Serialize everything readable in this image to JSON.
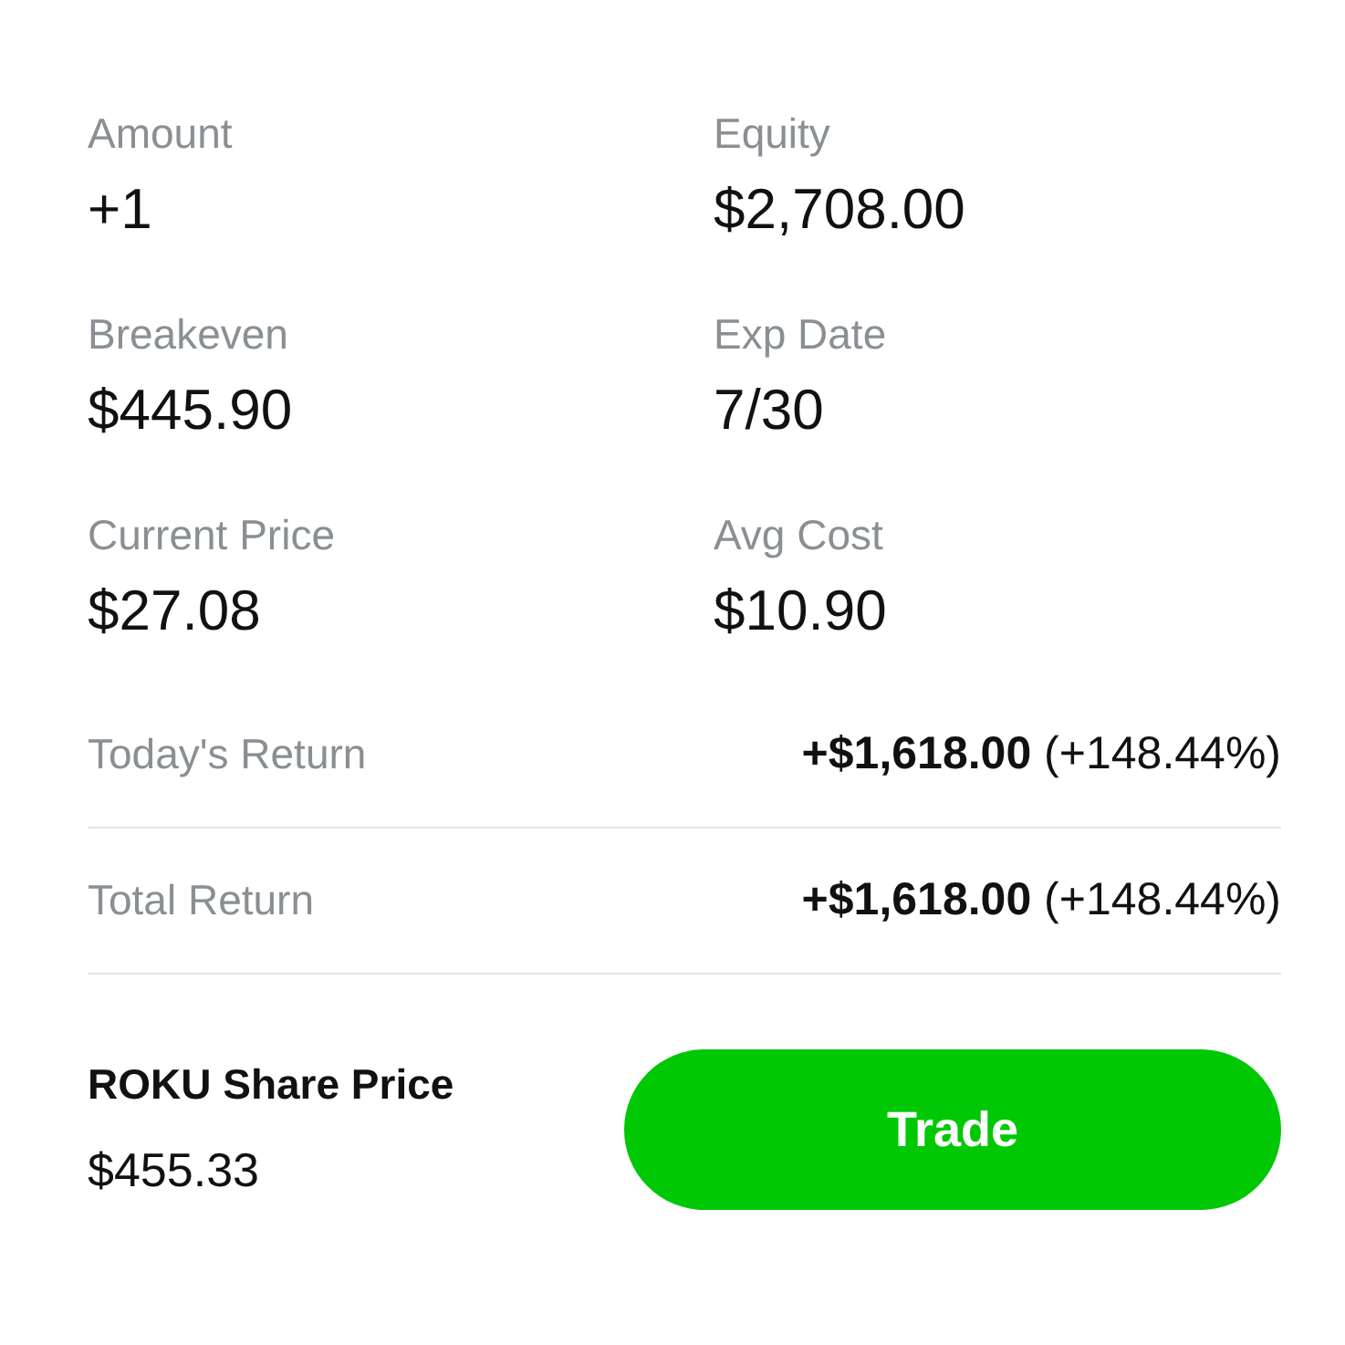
{
  "stats": [
    {
      "label": "Amount",
      "value": "+1"
    },
    {
      "label": "Equity",
      "value": "$2,708.00"
    },
    {
      "label": "Breakeven",
      "value": "$445.90"
    },
    {
      "label": "Exp Date",
      "value": "7/30"
    },
    {
      "label": "Current Price",
      "value": "$27.08"
    },
    {
      "label": "Avg Cost",
      "value": "$10.90"
    }
  ],
  "returns": [
    {
      "label": "Today's Return",
      "value": "**+$1,618.00** (+148.44%)"
    },
    {
      "label": "Total Return",
      "value": "**+$1,618.00** (+148.44%)"
    }
  ],
  "footer": {
    "title": "ROKU Share Price",
    "price": "$455.33",
    "button": "Trade"
  }
}
